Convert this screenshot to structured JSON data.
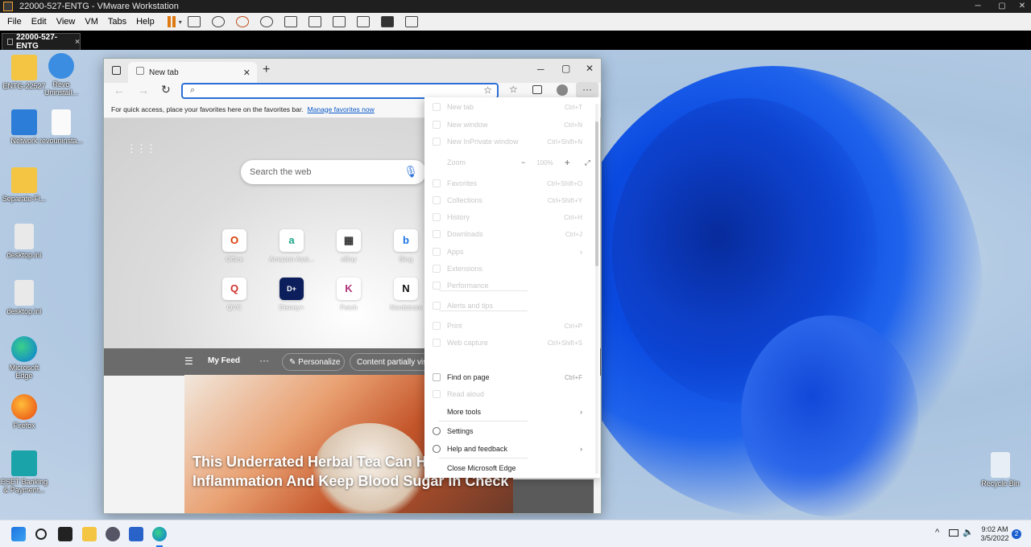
{
  "vm": {
    "title": "22000-527-ENTG - VMware Workstation",
    "menu": [
      "File",
      "Edit",
      "View",
      "VM",
      "Tabs",
      "Help"
    ],
    "tab_label": "22000-527-ENTG",
    "tab_close": "×"
  },
  "desktop": {
    "icons": [
      {
        "label": "ENTG-22527",
        "kind": "folder"
      },
      {
        "label": "Revo Uninstall...",
        "kind": "app"
      },
      {
        "label": "Network",
        "kind": "network"
      },
      {
        "label": "revouninsta...",
        "kind": "file"
      },
      {
        "label": "Separate-Fi...",
        "kind": "folder"
      },
      {
        "label": "desktop.ini",
        "kind": "gear-file"
      },
      {
        "label": "desktop.ini",
        "kind": "gear-file"
      },
      {
        "label": "Microsoft Edge",
        "kind": "edge"
      },
      {
        "label": "Firefox",
        "kind": "firefox"
      },
      {
        "label": "ESET Banking & Payment...",
        "kind": "eset"
      },
      {
        "label": "Recycle Bin",
        "kind": "recycle"
      }
    ]
  },
  "edge": {
    "tab_title": "New tab",
    "favbar_text": "For quick access, place your favorites here on the favorites bar.",
    "favbar_link": "Manage favorites now",
    "search_placeholder": "Search the web",
    "tiles": [
      {
        "label": "Office",
        "glyph": "O",
        "color": "#d83b01"
      },
      {
        "label": "Amazon Assi...",
        "glyph": "a",
        "color": "#1aa58a"
      },
      {
        "label": "eBay",
        "glyph": "▦",
        "color": "#333"
      },
      {
        "label": "Bing",
        "glyph": "b",
        "color": "#1a73e8"
      },
      {
        "label": "QVC",
        "glyph": "Q",
        "color": "#d0312d"
      },
      {
        "label": "Disney+",
        "glyph": "D+",
        "color": "#0c1e5b"
      },
      {
        "label": "Fetch",
        "glyph": "K",
        "color": "#b0337a"
      },
      {
        "label": "Nordstrom",
        "glyph": "N",
        "color": "#111"
      }
    ],
    "feed": {
      "label": "My Feed",
      "personalize": "Personalize",
      "content_status": "Content partially visi",
      "article_title": "This Underrated Herbal Tea Can Help Inflammation And Keep Blood Sugar In Check"
    },
    "menu": {
      "new_tab": "New tab",
      "new_tab_sc": "Ctrl+T",
      "new_window": "New window",
      "new_window_sc": "Ctrl+N",
      "inprivate": "New InPrivate window",
      "inprivate_sc": "Ctrl+Shift+N",
      "zoom": "Zoom",
      "zoom_value": "100%",
      "favorites": "Favorites",
      "favorites_sc": "Ctrl+Shift+O",
      "collections": "Collections",
      "collections_sc": "Ctrl+Shift+Y",
      "history": "History",
      "history_sc": "Ctrl+H",
      "downloads": "Downloads",
      "downloads_sc": "Ctrl+J",
      "apps": "Apps",
      "extensions": "Extensions",
      "performance": "Performance",
      "alerts": "Alerts and tips",
      "print": "Print",
      "print_sc": "Ctrl+P",
      "webcapture": "Web capture",
      "webcapture_sc": "Ctrl+Shift+S",
      "find": "Find on page",
      "find_sc": "Ctrl+F",
      "readaloud": "Read aloud",
      "moretools": "More tools",
      "settings": "Settings",
      "help": "Help and feedback",
      "close": "Close Microsoft Edge"
    }
  },
  "taskbar": {
    "time": "9:02 AM",
    "date": "3/5/2022",
    "notif_count": "2"
  }
}
